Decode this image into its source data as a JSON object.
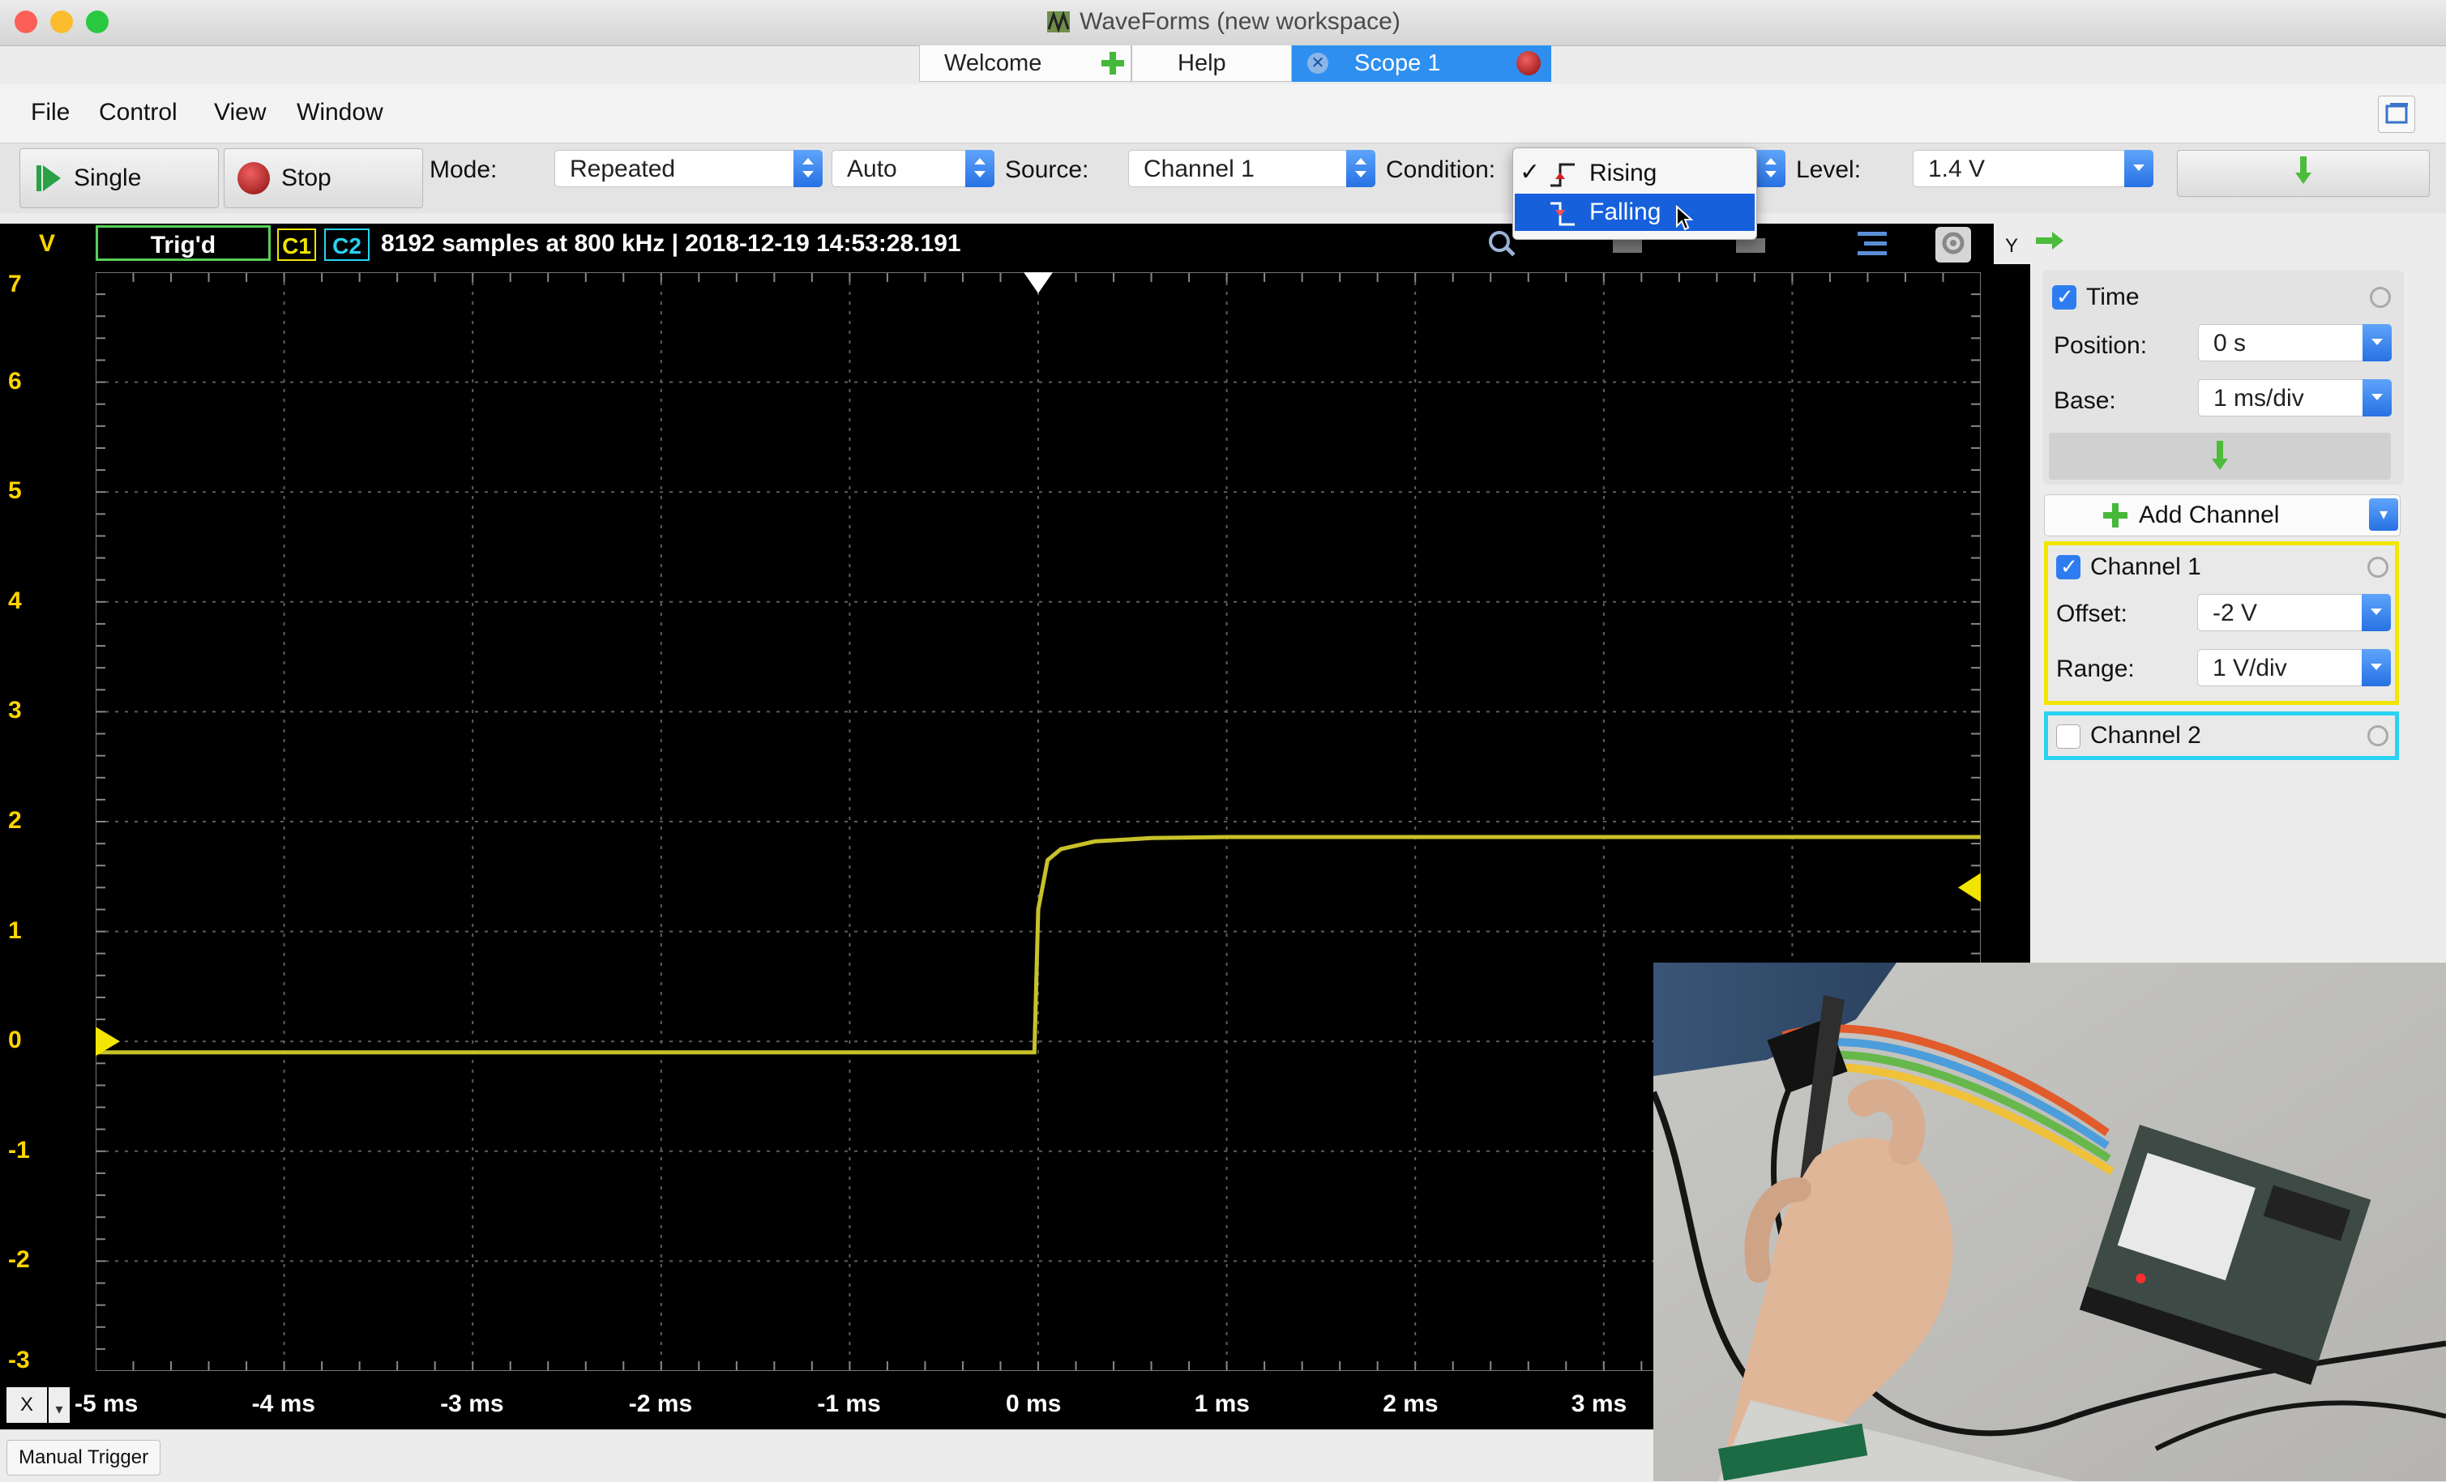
{
  "window": {
    "title": "WaveForms  (new workspace)"
  },
  "tabs": [
    {
      "label": "Welcome"
    },
    {
      "label": "Help"
    },
    {
      "label": "Scope 1"
    }
  ],
  "menu": [
    "File",
    "Control",
    "View",
    "Window"
  ],
  "toolbar": {
    "single_label": "Single",
    "stop_label": "Stop",
    "mode_label": "Mode:",
    "mode_value": "Repeated",
    "auto_value": "Auto",
    "source_label": "Source:",
    "source_value": "Channel 1",
    "condition_label": "Condition:",
    "level_label": "Level:",
    "level_value": "1.4 V"
  },
  "condition_dropdown": {
    "options": [
      "Rising",
      "Falling"
    ],
    "selected": "Rising",
    "highlighted": "Falling"
  },
  "infobar": {
    "y_unit": "V",
    "status": "Trig'd",
    "c1": "C1",
    "c2": "C2",
    "acquisition": "8192 samples at 800 kHz | 2018-12-19 14:53:28.191",
    "y_label": "Y"
  },
  "right_panel": {
    "time": {
      "label": "Time",
      "checked": true,
      "position_label": "Position:",
      "position_value": "0 s",
      "base_label": "Base:",
      "base_value": "1 ms/div"
    },
    "add_channel_label": "Add Channel",
    "channel1": {
      "label": "Channel 1",
      "checked": true,
      "offset_label": "Offset:",
      "offset_value": "-2 V",
      "range_label": "Range:",
      "range_value": "1 V/div",
      "color": "#f2e600"
    },
    "channel2": {
      "label": "Channel 2",
      "checked": false,
      "color": "#29d3f2"
    }
  },
  "xaxis": {
    "x_label": "X"
  },
  "statusbar": {
    "manual_trigger_label": "Manual Trigger"
  },
  "colors": {
    "trace": "#c8c22a",
    "grid": "#5e5e5e",
    "accent": "#2e8ff0"
  },
  "chart_data": {
    "type": "line",
    "title": "",
    "xlabel": "",
    "ylabel": "V",
    "xlim": [
      -5,
      5
    ],
    "ylim": [
      -3,
      7
    ],
    "x_ticks": [
      "-5 ms",
      "-4 ms",
      "-3 ms",
      "-2 ms",
      "-1 ms",
      "0 ms",
      "1 ms",
      "2 ms",
      "3 ms"
    ],
    "x_tick_values": [
      -5,
      -4,
      -3,
      -2,
      -1,
      0,
      1,
      2,
      3
    ],
    "y_ticks": [
      "7",
      "6",
      "5",
      "4",
      "3",
      "2",
      "1",
      "0",
      "-1",
      "-2",
      "-3"
    ],
    "y_tick_values": [
      7,
      6,
      5,
      4,
      3,
      2,
      1,
      0,
      -1,
      -2,
      -3
    ],
    "grid": true,
    "series": [
      {
        "name": "C1",
        "x": [
          -5,
          -0.02,
          0,
          0.05,
          0.12,
          0.3,
          0.6,
          1.0,
          2.0,
          3.0,
          4.0,
          5.0
        ],
        "y": [
          -0.1,
          -0.1,
          1.2,
          1.65,
          1.75,
          1.82,
          1.85,
          1.86,
          1.86,
          1.86,
          1.86,
          1.86
        ]
      }
    ],
    "trigger_time_ms": 0,
    "trigger_level_v": 1.4,
    "offset_marker_v": 0
  }
}
